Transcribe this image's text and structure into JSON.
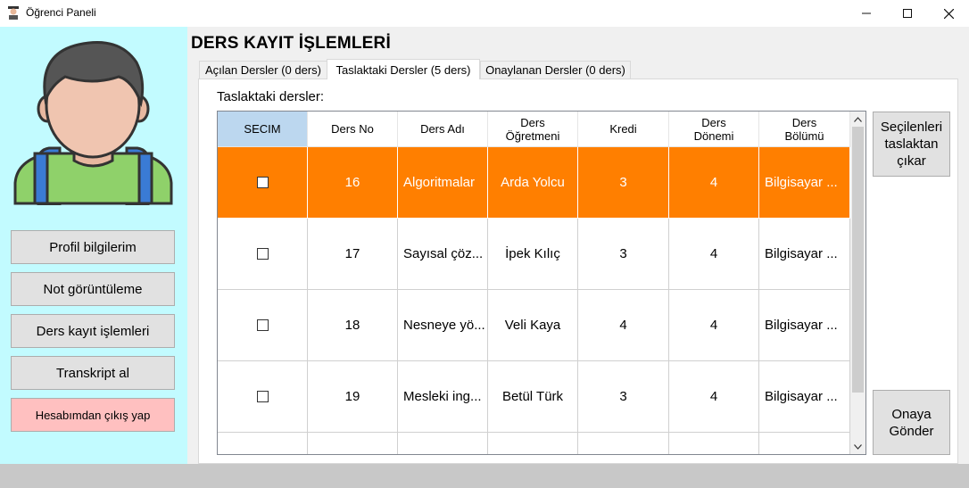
{
  "window": {
    "title": "Öğrenci Paneli"
  },
  "sidebar": {
    "buttons": [
      {
        "label": "Profil bilgilerim"
      },
      {
        "label": "Not görüntüleme"
      },
      {
        "label": "Ders kayıt işlemleri"
      },
      {
        "label": "Transkript al"
      }
    ],
    "logout_label": "Hesabımdan çıkış yap"
  },
  "main": {
    "heading": "DERS KAYIT İŞLEMLERİ",
    "tabs": [
      {
        "label": "Açılan Dersler (0 ders)"
      },
      {
        "label": "Taslaktaki Dersler (5 ders)"
      },
      {
        "label": "Onaylanan Dersler (0 ders)"
      }
    ],
    "active_tab_index": 1,
    "panel_label": "Taslaktaki dersler:",
    "table": {
      "headers": [
        {
          "line1": "SECIM",
          "line2": ""
        },
        {
          "line1": "Ders No",
          "line2": ""
        },
        {
          "line1": "Ders Adı",
          "line2": ""
        },
        {
          "line1": "Ders",
          "line2": "Öğretmeni"
        },
        {
          "line1": "Kredi",
          "line2": ""
        },
        {
          "line1": "Ders",
          "line2": "Dönemi"
        },
        {
          "line1": "Ders",
          "line2": "Bölümü"
        }
      ],
      "rows": [
        {
          "ders_no": "16",
          "ders_adi": "Algoritmalar",
          "ogretmen": "Arda Yolcu",
          "kredi": "3",
          "donem": "4",
          "bolum": "Bilgisayar ..."
        },
        {
          "ders_no": "17",
          "ders_adi": "Sayısal çöz...",
          "ogretmen": "İpek Kılıç",
          "kredi": "3",
          "donem": "4",
          "bolum": "Bilgisayar ..."
        },
        {
          "ders_no": "18",
          "ders_adi": "Nesneye yö...",
          "ogretmen": "Veli Kaya",
          "kredi": "4",
          "donem": "4",
          "bolum": "Bilgisayar ..."
        },
        {
          "ders_no": "19",
          "ders_adi": "Mesleki ing...",
          "ogretmen": "Betül Türk",
          "kredi": "3",
          "donem": "4",
          "bolum": "Bilgisayar ..."
        }
      ]
    },
    "remove_button": {
      "line1": "Seçilenleri",
      "line2": "taslaktan",
      "line3": "çıkar"
    },
    "submit_button": {
      "line1": "Onaya",
      "line2": "Gönder"
    }
  },
  "colors": {
    "sidebar_bg": "#c2fbff",
    "highlight_row": "#ff7f00",
    "selected_header": "#bcd7ef",
    "logout_bg": "#ffc0c0"
  }
}
